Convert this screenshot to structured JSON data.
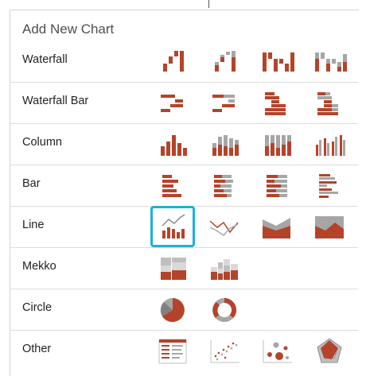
{
  "title": "Add New Chart",
  "rows": [
    {
      "label": "Waterfall"
    },
    {
      "label": "Waterfall Bar"
    },
    {
      "label": "Column"
    },
    {
      "label": "Bar"
    },
    {
      "label": "Line"
    },
    {
      "label": "Mekko"
    },
    {
      "label": "Circle"
    },
    {
      "label": "Other"
    }
  ],
  "selected": {
    "row": "Line",
    "icon": "line-column-combo"
  },
  "colors": {
    "accent": "#b5432a",
    "gray": "#a6a6a6",
    "selection": "#19b3d8"
  }
}
